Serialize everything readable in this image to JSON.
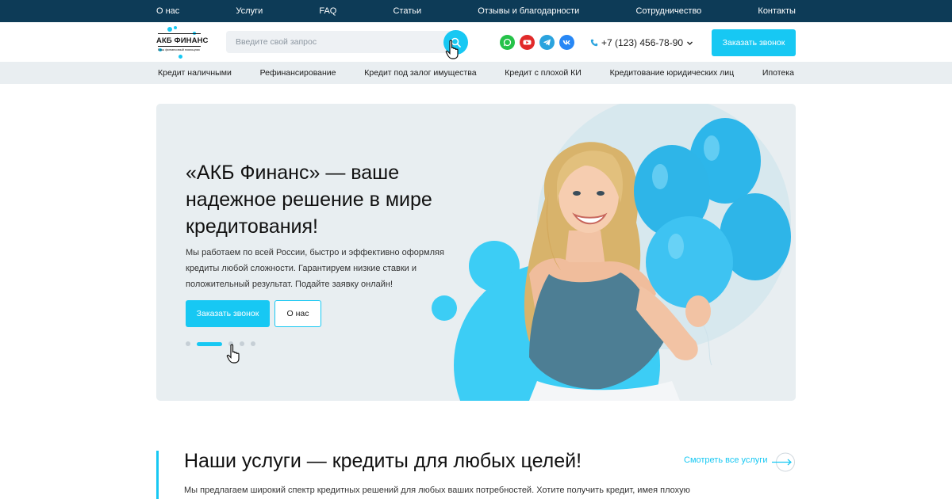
{
  "topbar": {
    "links": [
      "О нас",
      "Услуги",
      "FAQ",
      "Статьи",
      "Отзывы и благодарности",
      "Сотрудничество",
      "Контакты"
    ]
  },
  "header": {
    "logo_text": "АКБ ФИНАНС",
    "logo_tagline": "Ваш финансовый помощник",
    "search_placeholder": "Введите свой запрос",
    "phone": "+7 (123) 456-78-90",
    "call_button": "Заказать звонок",
    "social": [
      "whatsapp-icon",
      "youtube-icon",
      "telegram-icon",
      "vk-icon"
    ],
    "accent_color": "#17c8f3"
  },
  "nav": {
    "items": [
      "Кредит наличными",
      "Рефинансирование",
      "Кредит под залог имущества",
      "Кредит с плохой КИ",
      "Кредитование юридических лиц",
      "Ипотека"
    ]
  },
  "hero": {
    "title": "«АКБ Финанс» — ваше надежное решение в мире кредитования!",
    "text": "Мы работаем по всей России, быстро и эффективно оформляя кредиты любой сложности. Гарантируем низкие ставки и положительный результат. Подайте заявку онлайн!",
    "primary_button": "Заказать звонок",
    "secondary_button": "О нас",
    "slides_total": 5,
    "active_slide": 2
  },
  "services": {
    "title": "Наши услуги — кредиты для любых целей!",
    "link": "Смотреть все услуги",
    "text": "Мы предлагаем широкий спектр кредитных решений для любых ваших потребностей. Хотите получить кредит, имея плохую"
  }
}
